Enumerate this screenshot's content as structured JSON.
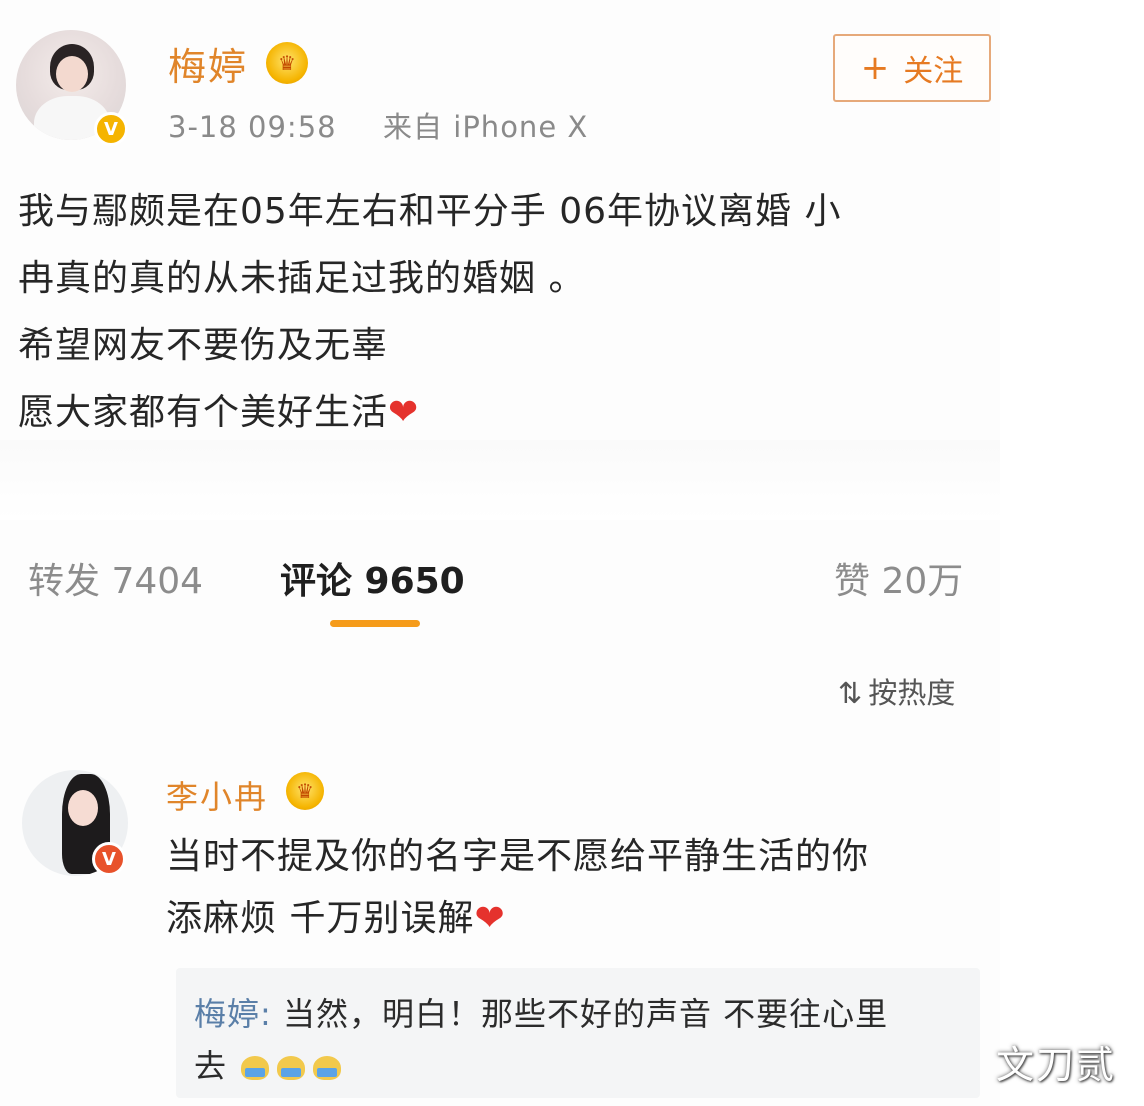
{
  "post": {
    "author": "梅婷",
    "timestamp": "3-18 09:58",
    "source": "来自 iPhone X",
    "follow_label": "关注",
    "follow_icon": "plus-icon",
    "content_lines": [
      "我与鄢颇是在05年左右和平分手  06年协议离婚 小",
      "冉真的真的从未插足过我的婚姻 。",
      "希望网友不要伤及无辜",
      "愿大家都有个美好生活"
    ],
    "heart": "❤"
  },
  "stats": {
    "repost": "转发 7404",
    "comments": "评论 9650",
    "likes": "赞 20万"
  },
  "sort": {
    "icon": "sort-icon",
    "label": "按热度"
  },
  "comment": {
    "author": "李小冉",
    "text_lines": [
      "当时不提及你的名字是不愿给平静生活的你",
      "添麻烦 千万别误解"
    ],
    "heart": "❤",
    "reply": {
      "author": "梅婷:",
      "text_line1": " 当然，明白！那些不好的声音 不要往心里",
      "text_line2": "去"
    }
  },
  "watermark": "文刀贰",
  "colors": {
    "accent_orange": "#e0852a",
    "underline": "#f59b1a",
    "reply_name": "#5a7fa8",
    "heart": "#e5322d"
  }
}
